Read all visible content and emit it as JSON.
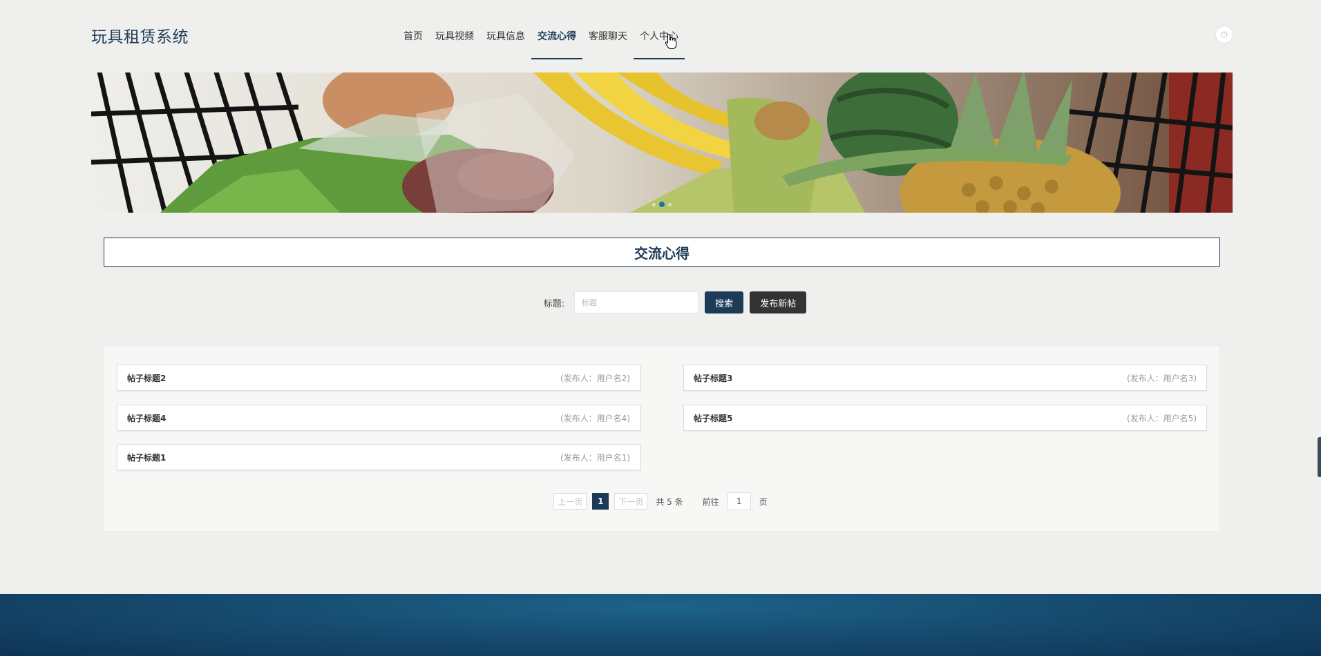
{
  "header": {
    "site_title": "玩具租赁系统",
    "nav": [
      {
        "label": "首页"
      },
      {
        "label": "玩具视频"
      },
      {
        "label": "玩具信息"
      },
      {
        "label": "交流心得"
      },
      {
        "label": "客服聊天"
      },
      {
        "label": "个人中心"
      }
    ],
    "active_nav": "交流心得",
    "power_icon": "power-icon"
  },
  "banner": {
    "slide_count": 3,
    "active_slide": 2
  },
  "section": {
    "title": "交流心得"
  },
  "search": {
    "label": "标题:",
    "placeholder": "标题",
    "value": "",
    "search_button": "搜索",
    "post_button": "发布新帖"
  },
  "posts": [
    {
      "title": "帖子标题2",
      "author": "(发布人：用户名2)"
    },
    {
      "title": "帖子标题3",
      "author": "(发布人：用户名3)"
    },
    {
      "title": "帖子标题4",
      "author": "(发布人：用户名4)"
    },
    {
      "title": "帖子标题5",
      "author": "(发布人：用户名5)"
    },
    {
      "title": "帖子标题1",
      "author": "(发布人：用户名1)"
    }
  ],
  "pagination": {
    "prev": "上一页",
    "current": "1",
    "next": "下一页",
    "total": "共 5 条",
    "goto_label": "前往",
    "goto_value": "1",
    "page_suffix": "页"
  },
  "colors": {
    "primary": "#1d3a57",
    "page_bg": "#efefed",
    "post_button": "#333333",
    "footer": "#164c70"
  }
}
